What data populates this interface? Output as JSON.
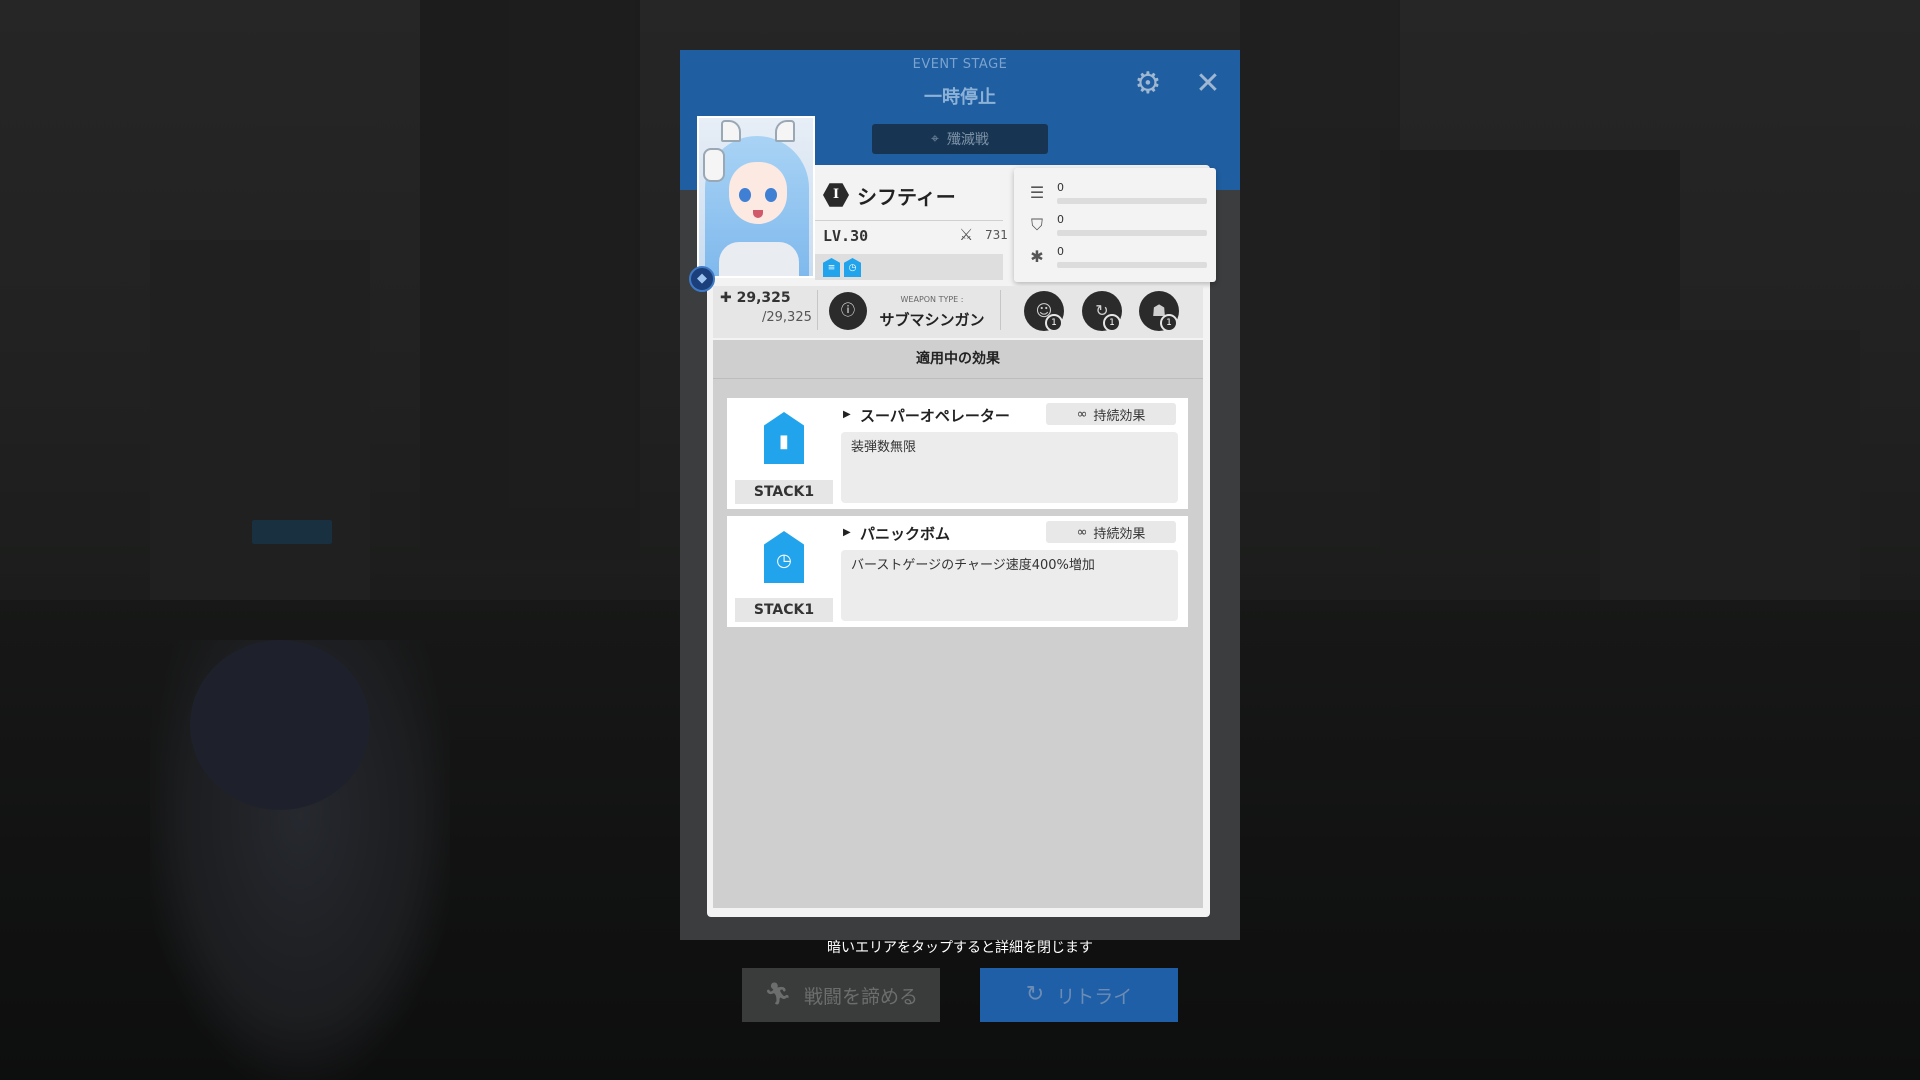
{
  "header": {
    "event_label": "EVENT STAGE",
    "title": "一時停止",
    "mode_icon": "crosshair-icon",
    "mode_label": "殲滅戦",
    "mode_subtitle": "ーーーーーーーーーーーー",
    "settings_icon": "gear-icon",
    "close_icon": "close-icon"
  },
  "character": {
    "burst": "I",
    "name": "シフティー",
    "level": "LV.30",
    "combat_power": "731",
    "element_icon": "water-element-icon",
    "hp_current": "29,325",
    "hp_max": "/29,325",
    "weapon_type_label": "WEAPON TYPE :",
    "weapon_name": "サブマシンガン",
    "skills": [
      {
        "icon": "skill-1-icon",
        "level": "1"
      },
      {
        "icon": "skill-2-icon",
        "level": "1"
      },
      {
        "icon": "burst-skill-icon",
        "level": "1"
      }
    ],
    "stats": [
      {
        "icon": "ammo-icon",
        "value": "0",
        "fill": 0
      },
      {
        "icon": "defense-icon",
        "value": "0",
        "fill": 0
      },
      {
        "icon": "burst-gauge-icon",
        "value": "0",
        "fill": 0
      }
    ]
  },
  "effects": {
    "title": "適用中の効果",
    "items": [
      {
        "icon": "magazine-icon",
        "stack": "STACK1",
        "name": "スーパーオペレーター",
        "duration": "持続効果",
        "description": "装弾数無限"
      },
      {
        "icon": "burst-charge-icon",
        "stack": "STACK1",
        "name": "パニックボム",
        "duration": "持続効果",
        "description": "バーストゲージのチャージ速度400%増加"
      }
    ]
  },
  "footer": {
    "hint": "暗いエリアをタップすると詳細を閉じます",
    "retreat_label": "戦闘を諦める",
    "retry_label": "リトライ"
  },
  "colors": {
    "header_blue": "#1f5ea1",
    "accent_cyan": "#22a4ec",
    "retry_blue": "#1f5fa8"
  }
}
